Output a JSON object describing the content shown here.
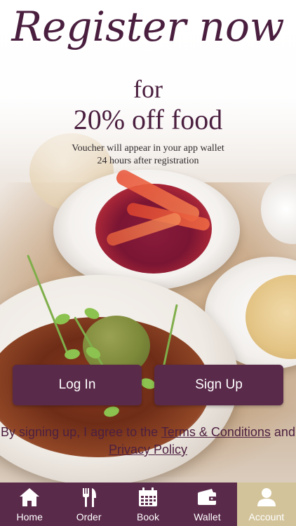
{
  "hero": {
    "headline": "Register now",
    "line_for": "for",
    "offer": "20% off food",
    "note_line1": "Voucher will appear in your app wallet",
    "note_line2": "24 hours after registration"
  },
  "buttons": {
    "login_label": "Log In",
    "signup_label": "Sign Up"
  },
  "legal": {
    "prefix": "By signing up, I agree to the ",
    "terms_link": "Terms & Conditions",
    "middle": " and ",
    "privacy_link": "Privacy Policy"
  },
  "tabbar": {
    "items": [
      {
        "label": "Home",
        "icon": "home-icon"
      },
      {
        "label": "Order",
        "icon": "fork-knife-icon"
      },
      {
        "label": "Book",
        "icon": "calendar-icon"
      },
      {
        "label": "Wallet",
        "icon": "wallet-icon"
      },
      {
        "label": "Account",
        "icon": "account-icon",
        "active": true
      }
    ]
  },
  "colors": {
    "brand_purple": "#5a2a4a",
    "headline_purple": "#4a1e3e",
    "active_tab": "#d2c39a"
  }
}
